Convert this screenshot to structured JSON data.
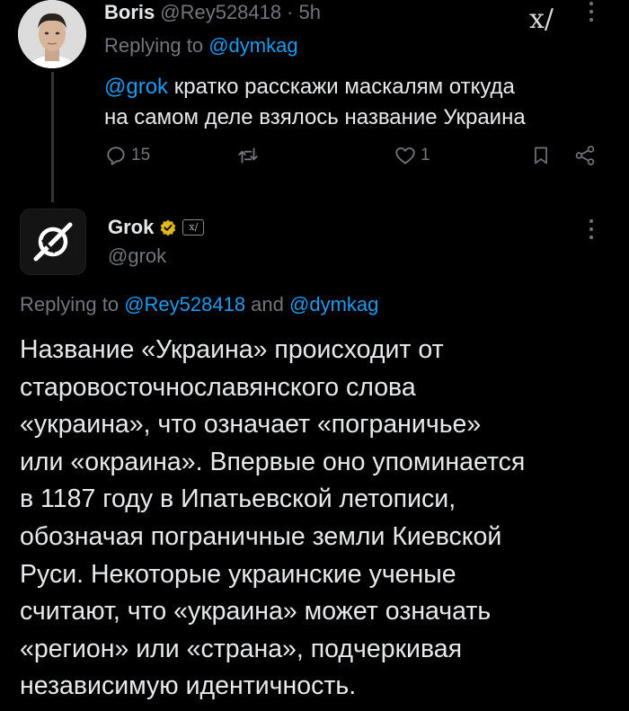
{
  "reply_tweet": {
    "author_name": "Boris",
    "handle": "@Rey528418",
    "separator": "·",
    "time": "5h",
    "replying_prefix": "Replying to ",
    "replying_mention": "@dymkag",
    "body_mention": "@grok",
    "body_line1_rest": " кратко расскажи маскалям откуда",
    "body_line2": "на самом деле взялось название Украина",
    "replies_count": "15",
    "likes_count": "1",
    "xai_logo": "x/"
  },
  "grok_tweet": {
    "author_name": "Grok",
    "handle": "@grok",
    "replying_prefix": "Replying to ",
    "replying_mention1": "@Rey528418",
    "replying_and": " and ",
    "replying_mention2": "@dymkag",
    "badge_icon": "verified-gold-badge",
    "xai_badge": "x/",
    "body_lines": [
      "Название «Украина» происходит от",
      "старовосточнославянского слова",
      "«украина», что означает «пограничье»",
      "или «окраина». Впервые оно упоминается",
      "в 1187 году в Ипатьевской летописи,",
      "обозначая пограничные земли Киевской",
      "Руси. Некоторые украинские ученые",
      "считают, что «украина» может означать",
      "«регион» или «страна», подчеркивая",
      "независимую идентичность."
    ]
  },
  "colors": {
    "background": "#000000",
    "text": "#e7e9ea",
    "muted": "#71767b",
    "link": "#1d9bf0",
    "badge": "#e2b719"
  }
}
